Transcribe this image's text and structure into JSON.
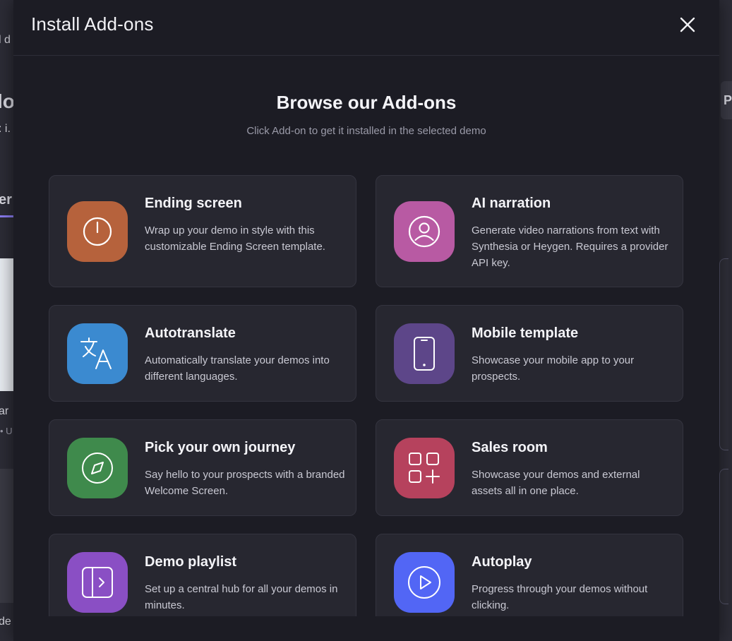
{
  "background": {
    "left_fragments": [
      "l d",
      "lo",
      ": i.",
      "er",
      "ar",
      "• U",
      "de"
    ],
    "right_button_label": "P"
  },
  "modal": {
    "title": "Install Add-ons",
    "heading": "Browse our Add-ons",
    "subheading": "Click Add-on to get it installed in the selected demo",
    "addons": [
      {
        "title": "Ending screen",
        "description": "Wrap up your demo in style with this customizable Ending Screen template.",
        "icon": "power-icon",
        "color": "#b6623c"
      },
      {
        "title": "AI narration",
        "description": "Generate video narrations from text with Synthesia or Heygen. Requires a provider API key.",
        "icon": "user-circle-icon",
        "color": "#b85aa3"
      },
      {
        "title": "Autotranslate",
        "description": "Automatically translate your demos into different languages.",
        "icon": "translate-icon",
        "color": "#3b8ad0"
      },
      {
        "title": "Mobile template",
        "description": "Showcase your mobile app to your prospects.",
        "icon": "mobile-icon",
        "color": "#5d4689"
      },
      {
        "title": "Pick your own journey",
        "description": "Say hello to your prospects with a branded Welcome Screen.",
        "icon": "compass-icon",
        "color": "#3f8a4c"
      },
      {
        "title": "Sales room",
        "description": "Showcase your demos and external assets all in one place.",
        "icon": "apps-add-icon",
        "color": "#b6425d"
      },
      {
        "title": "Demo playlist",
        "description": "Set up a central hub for all your demos in minutes.",
        "icon": "sidebar-expand-icon",
        "color": "#8a4fc4"
      },
      {
        "title": "Autoplay",
        "description": "Progress through your demos without clicking.",
        "icon": "play-circle-icon",
        "color": "#5266f5"
      }
    ]
  }
}
